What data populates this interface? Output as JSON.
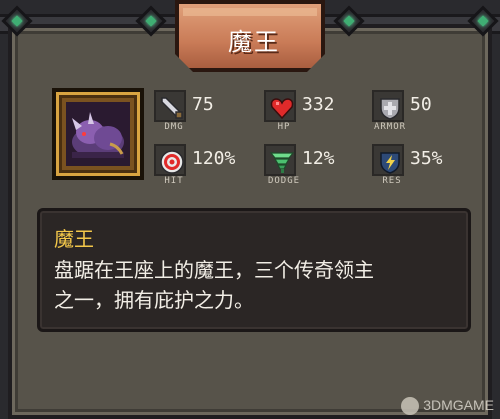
{
  "title": "魔王",
  "stats": {
    "dmg": {
      "value": "75",
      "label": "DMG",
      "icon": "sword-icon"
    },
    "hp": {
      "value": "332",
      "label": "HP",
      "icon": "heart-icon"
    },
    "armor": {
      "value": "50",
      "label": "ARMOR",
      "icon": "shield-icon"
    },
    "hit": {
      "value": "120%",
      "label": "HIT",
      "icon": "target-icon"
    },
    "dodge": {
      "value": "12%",
      "label": "DODGE",
      "icon": "tornado-icon"
    },
    "res": {
      "value": "35%",
      "label": "RES",
      "icon": "resist-shield-icon"
    }
  },
  "description": {
    "name": "魔王",
    "lines": [
      "盘踞在王座上的魔王，三个传奇领主",
      "之一，拥有庇护之力。"
    ]
  },
  "watermark": "3DMGAME",
  "colors": {
    "banner": "#c97b57",
    "name": "#f4c84a",
    "gem": "#3fae73"
  }
}
